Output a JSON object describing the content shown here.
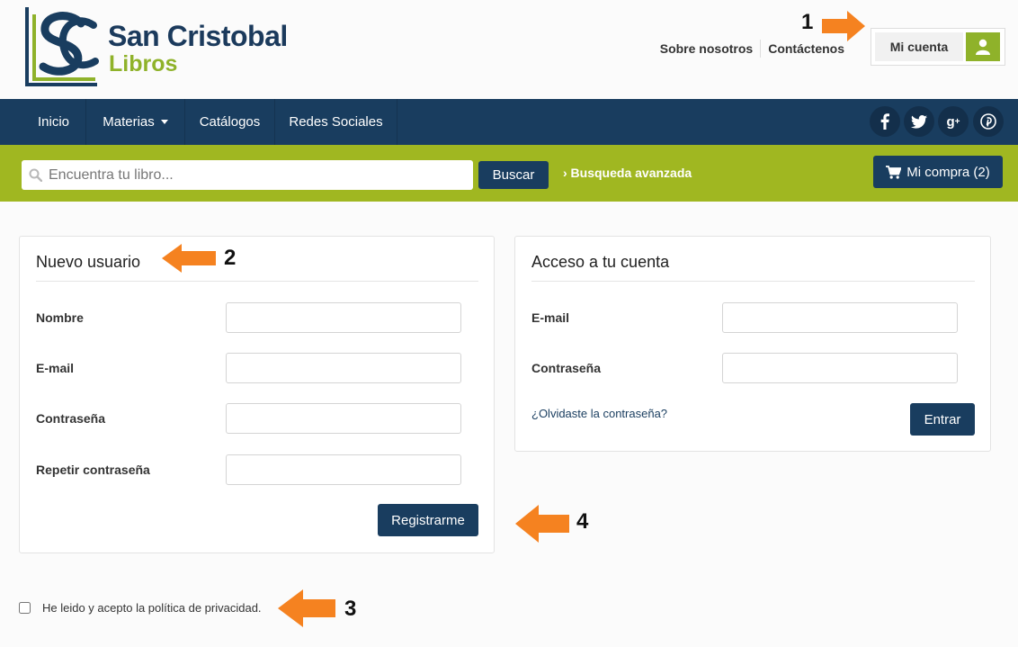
{
  "brand": {
    "name_line1": "San Cristobal",
    "name_line2": "Libros",
    "logo_icon": "san-cristobal-logo",
    "colors": {
      "navy": "#193d5f",
      "green": "#8fb22a",
      "lime_bar": "#a0b721"
    }
  },
  "header": {
    "links": [
      {
        "label": "Sobre nosotros"
      },
      {
        "label": "Contáctenos"
      }
    ],
    "account_label": "Mi cuenta",
    "account_icon": "user-icon"
  },
  "nav": {
    "items": [
      {
        "label": "Inicio"
      },
      {
        "label": "Materias"
      },
      {
        "label": "Catálogos"
      },
      {
        "label": "Redes Sociales"
      }
    ],
    "social": [
      {
        "icon": "facebook-icon",
        "glyph": "f"
      },
      {
        "icon": "twitter-icon",
        "glyph": "t"
      },
      {
        "icon": "google-plus-icon",
        "glyph": "g+"
      },
      {
        "icon": "pinterest-icon",
        "glyph": "p"
      }
    ]
  },
  "search": {
    "placeholder": "Encuentra tu libro...",
    "button_label": "Buscar",
    "advanced_label": "› Busqueda avanzada",
    "cart_label": "Mi compra (2)"
  },
  "register": {
    "title": "Nuevo usuario",
    "fields": [
      {
        "label": "Nombre",
        "value": ""
      },
      {
        "label": "E-mail",
        "value": ""
      },
      {
        "label": "Contraseña",
        "value": ""
      },
      {
        "label": "Repetir contraseña",
        "value": ""
      }
    ],
    "submit_label": "Registrarme"
  },
  "login": {
    "title": "Acceso a tu cuenta",
    "fields": [
      {
        "label": "E-mail",
        "value": ""
      },
      {
        "label": "Contraseña",
        "value": ""
      }
    ],
    "forgot_label": "¿Olvidaste la contraseña?",
    "submit_label": "Entrar"
  },
  "privacy": {
    "label": "He leido y acepto la política de privacidad.",
    "checked": false
  },
  "annotations": {
    "arrow_color": "#f58220",
    "numbers": [
      "1",
      "2",
      "3",
      "4"
    ]
  }
}
